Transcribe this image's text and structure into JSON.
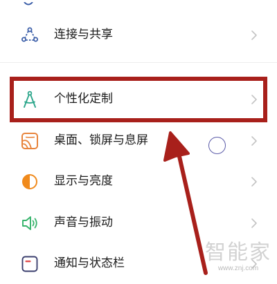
{
  "settings": {
    "items": [
      {
        "label": "连接与共享",
        "icon": "share-network-icon",
        "color": "#3b5ea8"
      },
      {
        "label": "个性化定制",
        "icon": "compass-icon",
        "color": "#2aa58a"
      },
      {
        "label": "桌面、锁屏与息屏",
        "icon": "wallpaper-icon",
        "color": "#e8833a"
      },
      {
        "label": "显示与亮度",
        "icon": "brightness-icon",
        "color": "#f08a1c"
      },
      {
        "label": "声音与振动",
        "icon": "speaker-icon",
        "color": "#35b36a"
      },
      {
        "label": "通知与状态栏",
        "icon": "notification-icon",
        "color": "#e04a4a"
      }
    ]
  },
  "annotation": {
    "highlight_color": "#a8201b",
    "highlighted_item": "个性化定制"
  },
  "watermark": {
    "text": "智能家",
    "url": "www.znj.com"
  }
}
